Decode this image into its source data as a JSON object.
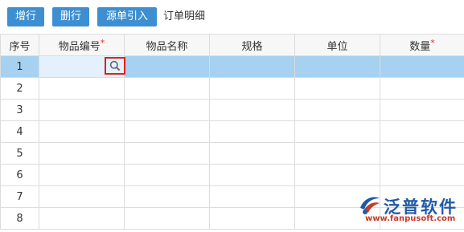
{
  "toolbar": {
    "add_row": "增行",
    "delete_row": "删行",
    "import_source": "源单引入",
    "title": "订单明细"
  },
  "table": {
    "columns": [
      "序号",
      "物品编号",
      "物品名称",
      "规格",
      "单位",
      "数量"
    ],
    "required_mark": "*",
    "rows": [
      "1",
      "2",
      "3",
      "4",
      "5",
      "6",
      "7",
      "8"
    ]
  },
  "watermark": {
    "brand": "泛普软件",
    "url": "www.fanpusoft.com"
  },
  "colors": {
    "button": "#3d8fd1",
    "selected_row": "#a6d1f0",
    "editing_cell": "#e4f1fc",
    "highlight_border": "#e02020",
    "required": "#e03030"
  },
  "icons": [
    "search-icon",
    "fanpu-logo-icon"
  ]
}
